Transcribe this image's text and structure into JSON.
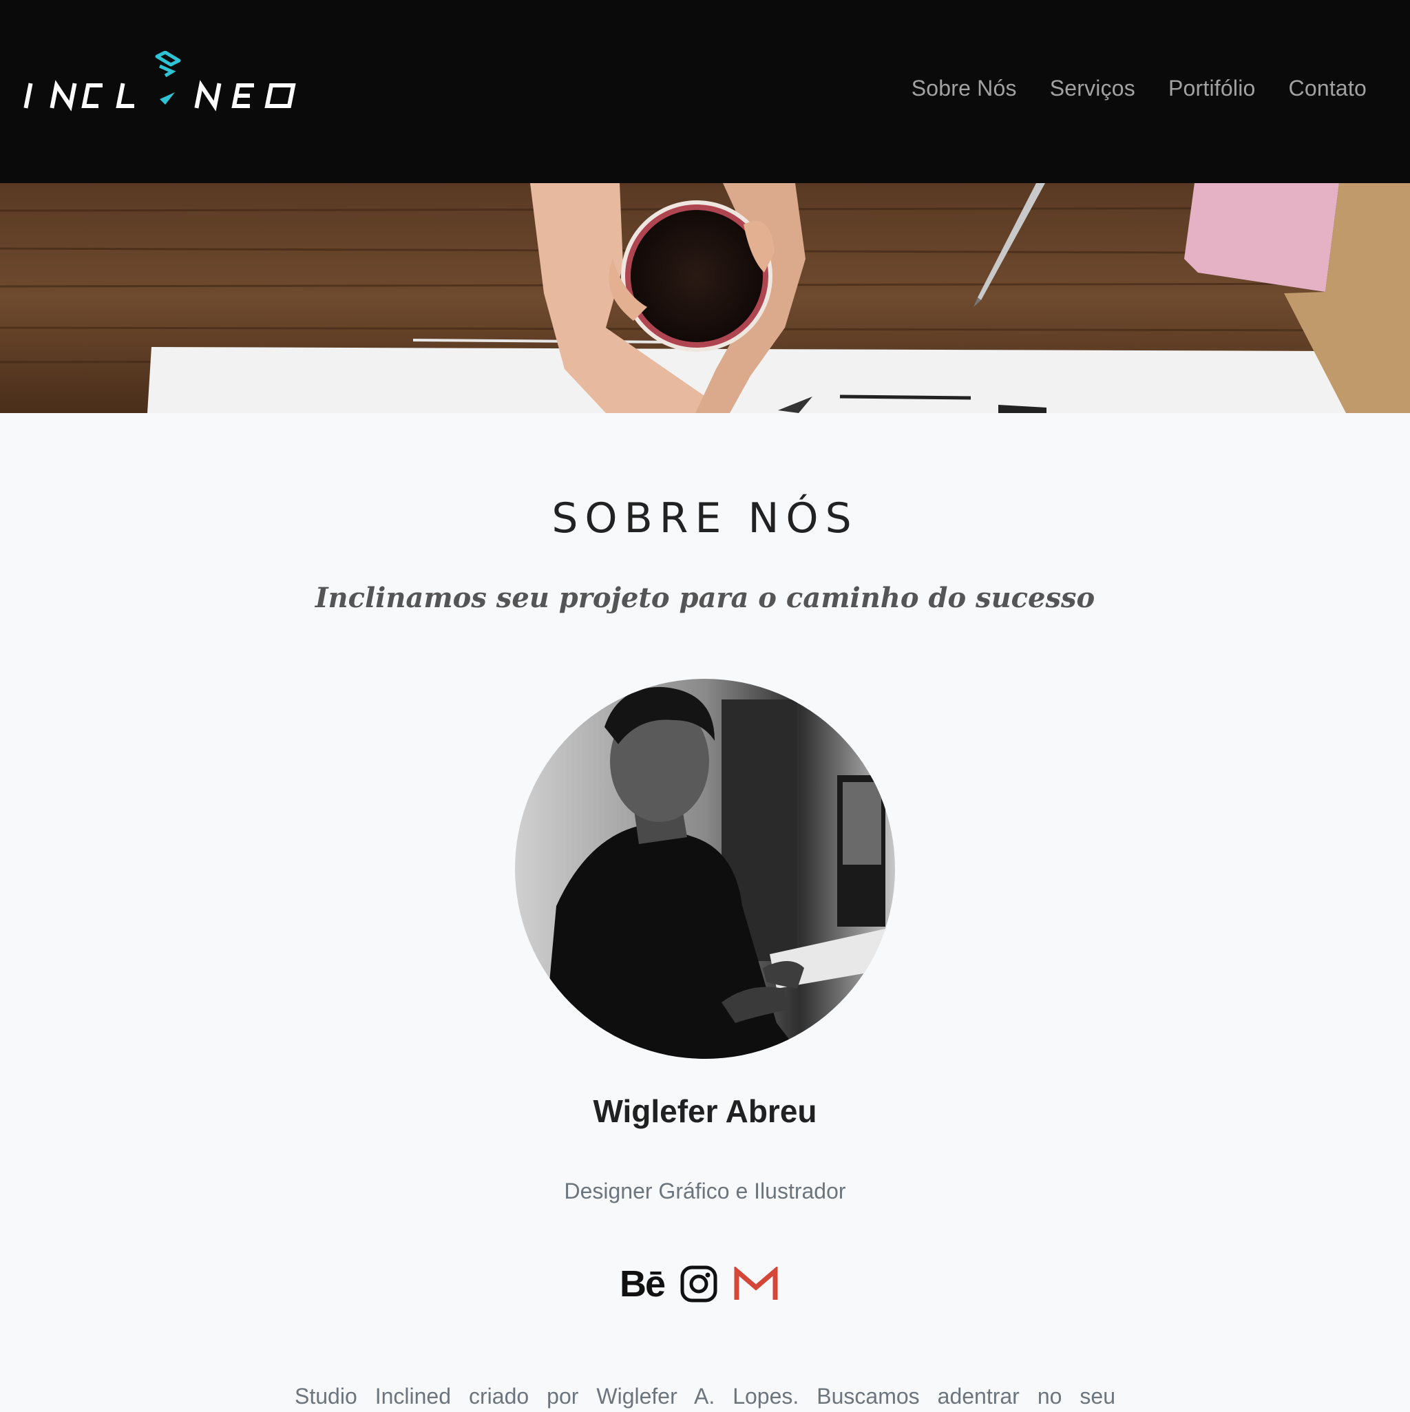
{
  "navbar": {
    "logo_alt": "INCLINED",
    "links": [
      "Sobre Nós",
      "Serviços",
      "Portifólio",
      "Contato"
    ]
  },
  "about": {
    "title": "SOBRE NÓS",
    "subtitle": "Inclinamos seu projeto para o caminho do sucesso",
    "person_name": "Wiglefer Abreu",
    "person_role": "Designer Gráfico e Ilustrador",
    "social": {
      "behance_label": "Bē",
      "icons": [
        "behance-icon",
        "instagram-icon",
        "gmail-icon"
      ]
    },
    "description": "Studio Inclined criado por Wiglefer A. Lopes. Buscamos adentrar no seu"
  },
  "colors": {
    "navbar_bg": "#0a0a0a",
    "nav_link": "#a2a2a2",
    "accent_cyan": "#2ec4d6",
    "page_bg": "#f8f9fa",
    "gmail_red": "#d44638"
  }
}
